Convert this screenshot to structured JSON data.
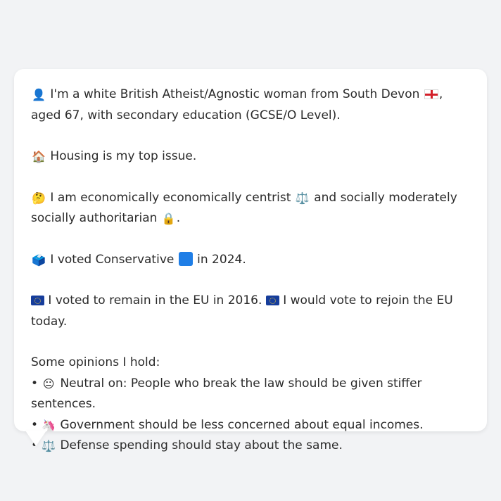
{
  "profile": {
    "line1_intro": "I'm a white British Atheist/Agnostic woman from South Devon",
    "line1_rest": ", aged 67, with secondary education (GCSE/O Level).",
    "housing": "Housing is my top issue.",
    "economics_pre": "I am economically economically centrist",
    "economics_mid": "and socially moderately socially authoritarian",
    "economics_post": ".",
    "vote_pre": "I voted Conservative",
    "vote_post": "in 2024.",
    "eu_1": "I voted to remain in the EU in 2016.",
    "eu_2": "I would vote to rejoin the EU today."
  },
  "icons": {
    "person": "person-silhouette-icon",
    "house": "house-icon",
    "thinking": "thinking-face-icon",
    "scales": "balance-scale-icon",
    "lock": "lock-icon",
    "ballot": "ballot-box-icon",
    "eu_flag": "eu-flag-icon",
    "england_flag": "england-flag-icon",
    "blue_square": "blue-square-icon",
    "neutral_face": "neutral-face-icon",
    "unicorn": "unicorn-icon"
  },
  "opinions": {
    "title": "Some opinions I hold:",
    "items": [
      {
        "bullet": "•",
        "text": "Neutral on: People who break the law should be given stiffer sentences."
      },
      {
        "bullet": "•",
        "text": "Government should be less concerned about equal incomes."
      },
      {
        "bullet": "•",
        "text": "Defense spending should stay about the same."
      }
    ]
  },
  "colors": {
    "background": "#f2f3f5",
    "bubble": "#ffffff",
    "text": "#2b2b2b",
    "conservative_blue": "#1f7ee6",
    "eu_blue": "#163d9b",
    "england_red": "#d3202a"
  }
}
